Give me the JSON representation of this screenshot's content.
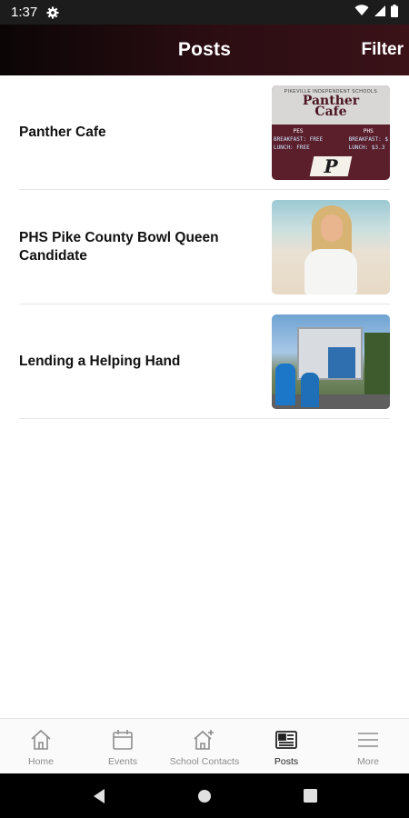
{
  "status_bar": {
    "time": "1:37"
  },
  "header": {
    "title": "Posts",
    "filter_label": "Filter"
  },
  "posts": [
    {
      "title": "Panther Cafe",
      "thumbnail": {
        "district": "PIKEVILLE INDEPENDENT SCHOOLS",
        "brand_line1": "Panther",
        "brand_line2": "Cafe",
        "col1_head": "PES",
        "col1_line1": "BREAKFAST: FREE",
        "col1_line2": "LUNCH: FREE",
        "col2_head": "PHS",
        "col2_line1": "BREAKFAST: $",
        "col2_line2": "LUNCH: $3.3",
        "logo_letter": "P"
      }
    },
    {
      "title": "PHS Pike County Bowl Queen Candidate"
    },
    {
      "title": "Lending a Helping Hand"
    }
  ],
  "bottom_nav": [
    {
      "label": "Home",
      "icon": "home-icon"
    },
    {
      "label": "Events",
      "icon": "calendar-icon"
    },
    {
      "label": "School Contacts",
      "icon": "school-contacts-icon"
    },
    {
      "label": "Posts",
      "icon": "posts-icon",
      "active": true
    },
    {
      "label": "More",
      "icon": "menu-icon"
    }
  ],
  "colors": {
    "header_dark": "#0b0506",
    "header_maroon": "#3a1218",
    "nav_active": "#222222",
    "nav_inactive": "#8c8c8c"
  }
}
